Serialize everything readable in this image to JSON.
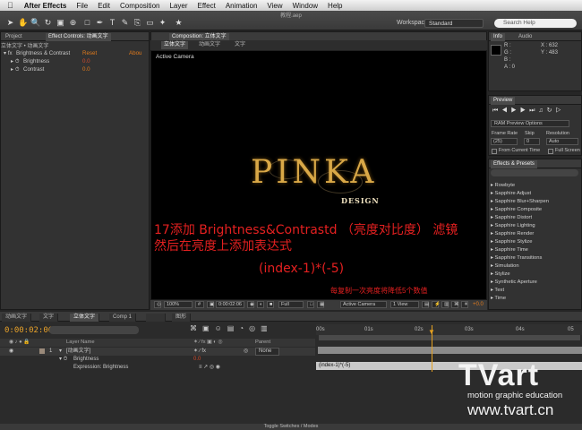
{
  "menubar": {
    "app": "After Effects",
    "items": [
      "File",
      "Edit",
      "Composition",
      "Layer",
      "Effect",
      "Animation",
      "View",
      "Window",
      "Help"
    ]
  },
  "window_title": "教程.aep",
  "workspace": {
    "label": "Workspace:",
    "value": "Standard"
  },
  "search": {
    "placeholder": "Search Help"
  },
  "effect_controls": {
    "tabs": [
      "Project",
      "Effect Controls: 动画文字"
    ],
    "subtitle": "立体文字 • 动画文字",
    "effect_name": "Brightness & Contrast",
    "reset": "Reset",
    "about": "Abou",
    "params": [
      {
        "label": "Brightness",
        "value": "0.0"
      },
      {
        "label": "Contrast",
        "value": "0.0"
      }
    ]
  },
  "composition": {
    "tab": "Composition: 立体文字",
    "breadcrumb": [
      "立体文字",
      "动画文字",
      "文字"
    ],
    "camera_label": "Active Camera",
    "logo_main": "PINKA",
    "logo_sub": "DESIGN",
    "zoom": "100%",
    "timecode": "0:00:02:06",
    "resolution": "Full",
    "camera_select": "Active Camera",
    "views": "1 View",
    "exposure": "+0.0"
  },
  "overlay": {
    "line1": "17添加 Brightness&Contrastd （亮度对比度） 滤镜",
    "line2": "然后在亮度上添加表达式",
    "line3": "(index-1)*(-5)",
    "line4": "每复制一次亮度将降低5个数值"
  },
  "info": {
    "tabs": [
      "Info",
      "Audio"
    ],
    "r": "R :",
    "g": "G :",
    "b": "B :",
    "a": "A : 0",
    "x": "X : 632",
    "y": "Y : 483"
  },
  "preview": {
    "title": "Preview",
    "ram_option": "RAM Preview Options",
    "frame_rate_label": "Frame Rate",
    "skip_label": "Skip",
    "resolution_label": "Resolution",
    "frame_rate": "(25)",
    "skip": "0",
    "resolution": "Auto",
    "from_current": "From Current Time",
    "full_screen": "Full Screen"
  },
  "effects_presets": {
    "title": "Effects & Presets",
    "items": [
      "Rowbyte",
      "Sapphire Adjust",
      "Sapphire Blur+Sharpen",
      "Sapphire Composite",
      "Sapphire Distort",
      "Sapphire Lighting",
      "Sapphire Render",
      "Sapphire Stylize",
      "Sapphire Time",
      "Sapphire Transitions",
      "Simulation",
      "Stylize",
      "Synthetic Aperture",
      "Text",
      "Time"
    ]
  },
  "timeline": {
    "tabs": [
      "动画文字",
      "文字",
      "立体文字",
      "Comp 1",
      "",
      "图形"
    ],
    "timecode": "0:00:02:06",
    "headers": {
      "layer_name": "Layer Name",
      "parent": "Parent"
    },
    "layer": {
      "index": "1",
      "name": "[动画文字]",
      "parent": "None"
    },
    "property": {
      "name": "Brightness",
      "value": "0.0"
    },
    "expression": {
      "label": "Expression: Brightness",
      "value": "(index-1)*(-5)"
    },
    "ruler": [
      "00s",
      "01s",
      "02s",
      "03s",
      "04s",
      "05"
    ],
    "playhead_seconds": 2.24,
    "toggle": "Toggle Switches / Modes"
  },
  "watermark": {
    "logo": "TVart",
    "tagline": "motion graphic education",
    "url": "www.tvart.cn"
  },
  "colors": {
    "accent_orange": "#e07a1c",
    "overlay_red": "#e42020",
    "logo_gold": "#d9a847"
  }
}
